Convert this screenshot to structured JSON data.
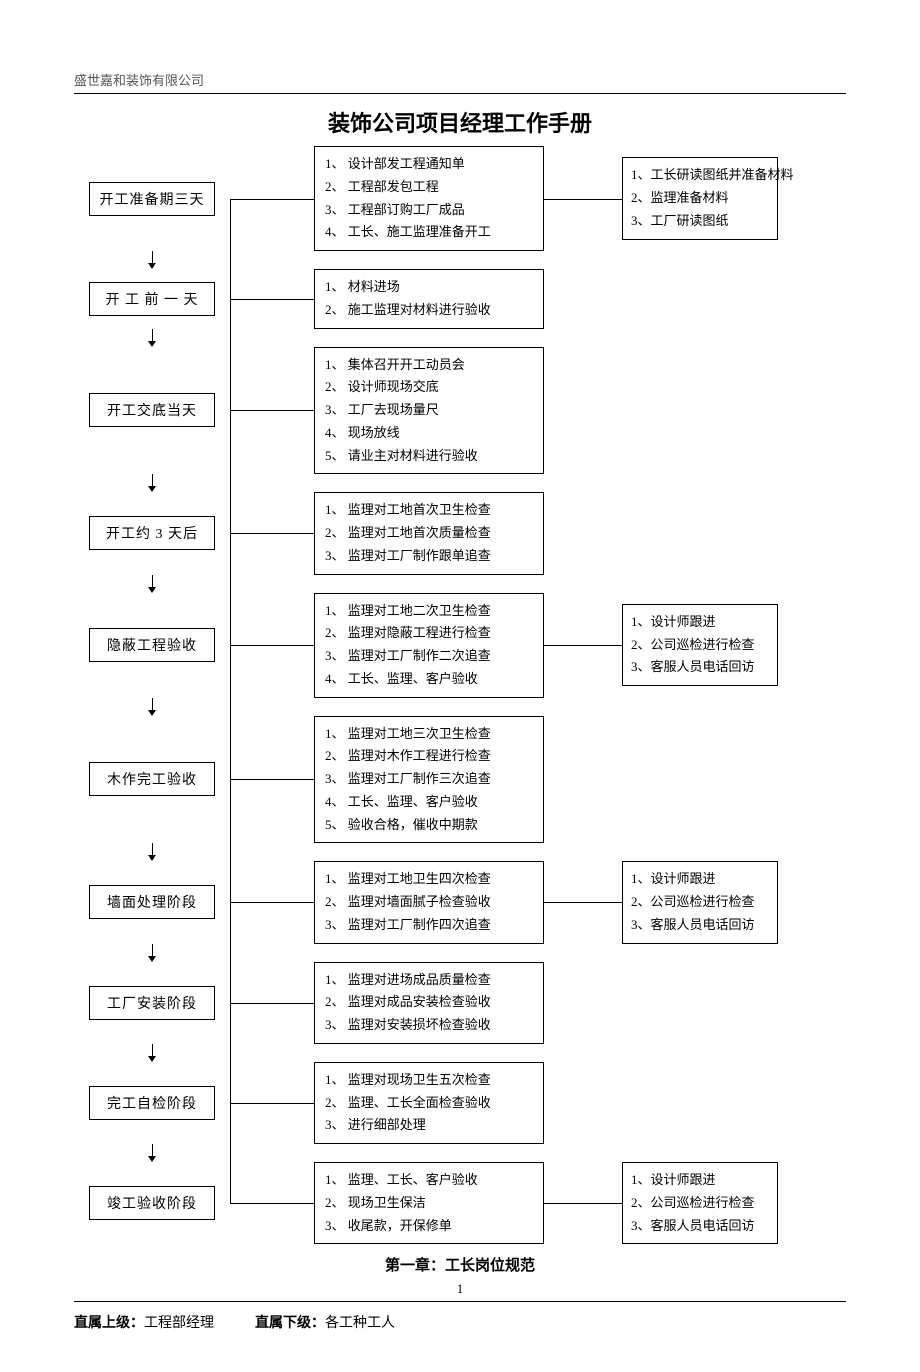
{
  "header": {
    "company": "盛世嘉和装饰有限公司"
  },
  "title": "装饰公司项目经理工作手册",
  "phases": [
    {
      "label": "开工准备期三天",
      "mid": [
        "1、  设计部发工程通知单",
        "2、  工程部发包工程",
        "3、  工程部订购工厂成品",
        "4、  工长、施工监理准备开工"
      ],
      "right": [
        "1、工长研读图纸并准备材料",
        "2、监理准备材料",
        "3、工厂研读图纸"
      ]
    },
    {
      "label": "开 工 前 一 天",
      "mid": [
        "1、  材料进场",
        "2、  施工监理对材料进行验收"
      ],
      "right": null
    },
    {
      "label": "开工交底当天",
      "mid": [
        "1、  集体召开开工动员会",
        "2、  设计师现场交底",
        "3、  工厂去现场量尺",
        "4、  现场放线",
        "5、  请业主对材料进行验收"
      ],
      "right": null
    },
    {
      "label": "开工约 3 天后",
      "mid": [
        "1、  监理对工地首次卫生检查",
        "2、  监理对工地首次质量检查",
        "3、  监理对工厂制作跟单追查"
      ],
      "right": null
    },
    {
      "label": "隐蔽工程验收",
      "mid": [
        "1、  监理对工地二次卫生检查",
        "2、  监理对隐蔽工程进行检查",
        "3、  监理对工厂制作二次追查",
        "4、  工长、监理、客户验收"
      ],
      "right": [
        "1、设计师跟进",
        "2、公司巡检进行检查",
        "3、客服人员电话回访"
      ]
    },
    {
      "label": "木作完工验收",
      "mid": [
        "1、  监理对工地三次卫生检查",
        "2、  监理对木作工程进行检查",
        "3、  监理对工厂制作三次追查",
        "4、  工长、监理、客户验收",
        "5、  验收合格，催收中期款"
      ],
      "right": null
    },
    {
      "label": "墙面处理阶段",
      "mid": [
        "1、  监理对工地卫生四次检查",
        "2、  监理对墙面腻子检查验收",
        "3、  监理对工厂制作四次追查"
      ],
      "right": [
        "1、设计师跟进",
        "2、公司巡检进行检查",
        "3、客服人员电话回访"
      ]
    },
    {
      "label": "工厂安装阶段",
      "mid": [
        "1、  监理对进场成品质量检查",
        "2、  监理对成品安装检查验收",
        "3、  监理对安装损坏检查验收"
      ],
      "right": null
    },
    {
      "label": "完工自检阶段",
      "mid": [
        "1、  监理对现场卫生五次检查",
        "2、  监理、工长全面检查验收",
        "3、  进行细部处理"
      ],
      "right": null
    },
    {
      "label": "竣工验收阶段",
      "mid": [
        "1、  监理、工长、客户验收",
        "2、  现场卫生保洁",
        "3、  收尾款，开保修单"
      ],
      "right": [
        "1、设计师跟进",
        "2、公司巡检进行检查",
        "3、客服人员电话回访"
      ]
    }
  ],
  "chapter": "第一章：工长岗位规范",
  "pagenum": "1",
  "relations": {
    "sup_label": "直属上级：",
    "sup_value": "工程部经理",
    "sub_label": "直属下级：",
    "sub_value": "各工种工人"
  }
}
